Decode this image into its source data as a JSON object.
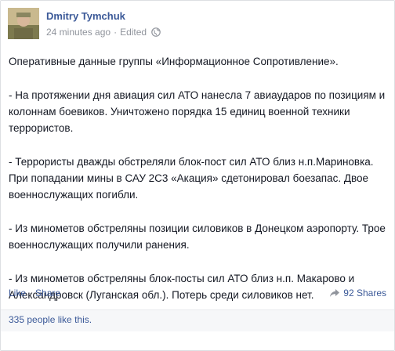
{
  "post": {
    "author": "Dmitry Tymchuk",
    "timestamp": "24 minutes ago",
    "edited": "Edited",
    "paragraphs": [
      "Оперативные данные группы «Информационное Сопротивление».",
      "- На протяжении дня авиация сил АТО нанесла 7 авиаударов по позициям и колоннам боевиков. Уничтожено порядка 15 единиц военной техники террористов.",
      "- Террористы дважды обстреляли блок-пост сил АТО близ н.п.Мариновка. При попадании мины в САУ 2С3 «Акация» сдетонировал боезапас. Двое военнослужащих погибли.",
      "- Из минометов обстреляны позиции силовиков в Донецком аэропорту. Трое военнослужащих получили ранения.",
      "- Из минометов обстреляны блок-посты сил АТО близ н.п. Макарово и Александровск (Луганская обл.). Потерь среди силовиков нет."
    ]
  },
  "actions": {
    "like": "Like",
    "share": "Share",
    "shares_count": "92 Shares"
  },
  "likes_summary": "335 people like this.",
  "icons": {
    "privacy": "globe-icon",
    "shares": "share-icon"
  },
  "colors": {
    "link": "#3b5998",
    "meta": "#90949c",
    "text": "#141823"
  }
}
